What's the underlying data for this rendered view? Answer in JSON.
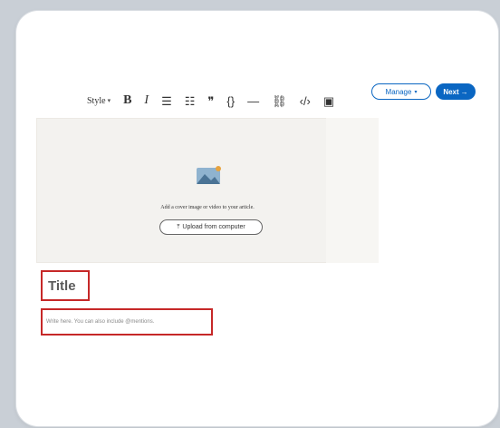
{
  "toolbar": {
    "style_label": "Style",
    "style_caret": "▾",
    "bold_glyph": "B",
    "italic_glyph": "I",
    "bullet_list_glyph": "☰",
    "numbered_list_glyph": "☷",
    "quote_glyph": "❞",
    "code_glyph": "{}",
    "divider_glyph": "—",
    "link_glyph": "⛓",
    "embed_glyph": "‹/›",
    "image_glyph": "▣"
  },
  "header": {
    "manage_label": "Manage",
    "manage_caret": "▾",
    "next_label": "Next",
    "next_arrow": "→"
  },
  "cover": {
    "prompt_text": "Add a cover image or video to your article.",
    "upload_label": "Upload from computer",
    "upload_icon_glyph": "⤒"
  },
  "editor": {
    "title_placeholder": "Title",
    "body_placeholder": "Write here. You can also include @mentions."
  },
  "colors": {
    "accent": "#0a66c2",
    "highlight_box": "#c62828",
    "cover_bg": "#f3f2ef"
  }
}
